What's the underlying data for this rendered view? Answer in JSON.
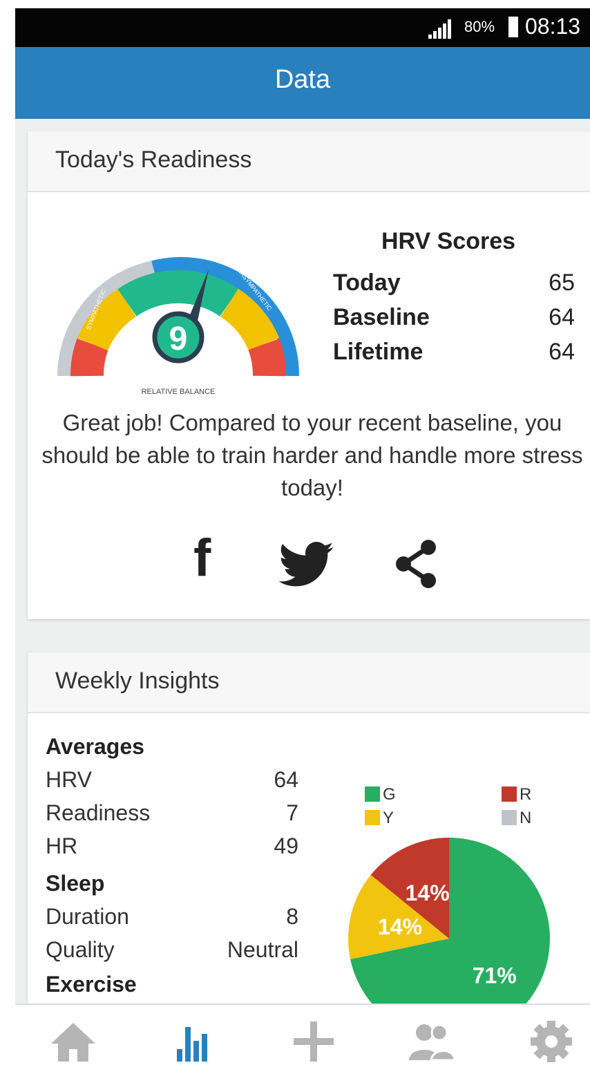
{
  "status_bar": {
    "battery_percent": "80%",
    "time": "08:13"
  },
  "header": {
    "title": "Data"
  },
  "readiness": {
    "title": "Today's Readiness",
    "gauge": {
      "value": "9",
      "label_sympathetic": "SYMPATHETIC",
      "label_parasympathetic": "PARASYMPATHETIC",
      "caption": "RELATIVE BALANCE"
    },
    "hrv": {
      "title": "HRV Scores",
      "rows": [
        {
          "label": "Today",
          "value": "65"
        },
        {
          "label": "Baseline",
          "value": "64"
        },
        {
          "label": "Lifetime",
          "value": "64"
        }
      ]
    },
    "message": "Great job! Compared to your recent baseline, you should be able to train harder and handle more stress today!",
    "share": {
      "facebook_icon": "facebook-icon",
      "twitter_icon": "twitter-icon",
      "share_icon": "share-icon"
    }
  },
  "insights": {
    "title": "Weekly Insights",
    "averages": {
      "heading": "Averages",
      "rows": [
        {
          "label": "HRV",
          "value": "64"
        },
        {
          "label": "Readiness",
          "value": "7"
        },
        {
          "label": "HR",
          "value": "49"
        }
      ]
    },
    "sleep": {
      "heading": "Sleep",
      "rows": [
        {
          "label": "Duration",
          "value": "8"
        },
        {
          "label": "Quality",
          "value": "Neutral"
        }
      ]
    },
    "exercise": {
      "heading": "Exercise"
    },
    "legend": [
      {
        "key": "G",
        "color": "#27ae60"
      },
      {
        "key": "R",
        "color": "#c0392b"
      },
      {
        "key": "Y",
        "color": "#f1c40f"
      },
      {
        "key": "N",
        "color": "#bdc3c7"
      }
    ]
  },
  "chart_data": {
    "type": "pie",
    "slices": [
      {
        "name": "G",
        "label": "71%",
        "value": 71,
        "color": "#27ae60"
      },
      {
        "name": "Y",
        "label": "14%",
        "value": 14,
        "color": "#f1c40f"
      },
      {
        "name": "R",
        "label": "14%",
        "value": 14,
        "color": "#c0392b"
      }
    ],
    "start_angle": "12 o'clock",
    "direction": "clockwise"
  },
  "nav": {
    "items": [
      {
        "name": "home",
        "icon": "home-icon",
        "active": false
      },
      {
        "name": "data",
        "icon": "bar-chart-icon",
        "active": true
      },
      {
        "name": "add",
        "icon": "plus-icon",
        "active": false
      },
      {
        "name": "community",
        "icon": "people-icon",
        "active": false
      },
      {
        "name": "settings",
        "icon": "gear-icon",
        "active": false
      }
    ]
  },
  "colors": {
    "appbar": "#2a7fbd",
    "active": "#2a7fbd",
    "inactive": "#b5b5b5",
    "gauge_green": "#22b88e",
    "gauge_yellow": "#f2c200",
    "gauge_red": "#e84c3d",
    "gauge_blue": "#2a8fd9",
    "gauge_grey": "#c5cbd0"
  }
}
